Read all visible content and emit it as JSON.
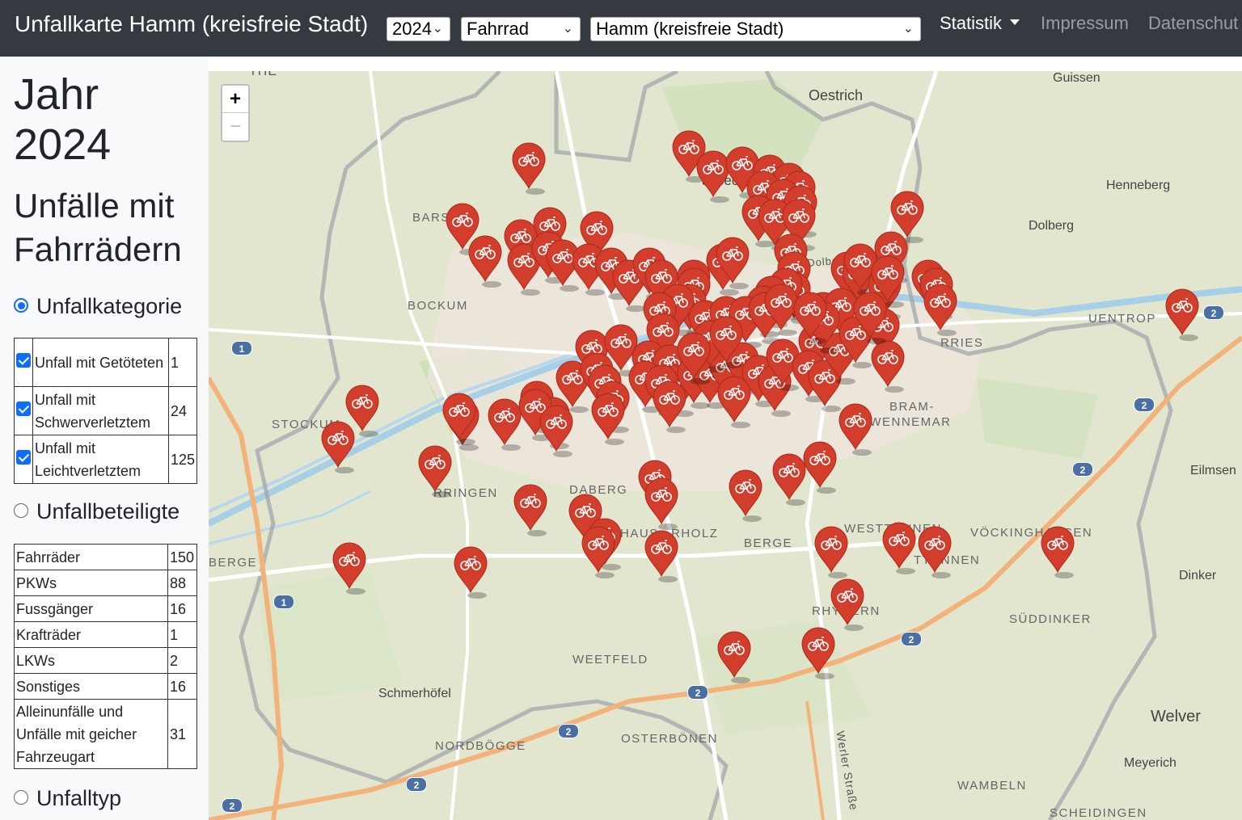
{
  "navbar": {
    "brand": "Unfallkarte Hamm (kreisfreie Stadt)",
    "year_select": "2024",
    "vehicle_select": "Fahrrad",
    "region_select": "Hamm (kreisfreie Stadt)",
    "links": [
      "Statistik",
      "Impressum",
      "Datenschut"
    ]
  },
  "sidebar": {
    "year_title": "Jahr 2024",
    "subtitle": "Unfälle mit Fahrrädern",
    "section_category": "Unfallkategorie",
    "categories": [
      {
        "label": "Unfall mit Getöteten",
        "count": "1"
      },
      {
        "label": "Unfall mit Schwerverletztem",
        "count": "24"
      },
      {
        "label": "Unfall mit Leichtverletztem",
        "count": "125"
      }
    ],
    "section_participants": "Unfallbeteiligte",
    "participants": [
      {
        "label": "Fahrräder",
        "count": "150"
      },
      {
        "label": "PKWs",
        "count": "88"
      },
      {
        "label": "Fussgänger",
        "count": "16"
      },
      {
        "label": "Krafträder",
        "count": "1"
      },
      {
        "label": "LKWs",
        "count": "2"
      },
      {
        "label": "Sonstiges",
        "count": "16"
      },
      {
        "label": "Alleinunfälle und Unfälle mit geicher Fahrzeugart",
        "count": "31"
      }
    ],
    "section_type": "Unfalltyp"
  },
  "map": {
    "zoom_in": "+",
    "zoom_out": "−",
    "marker_color": "#d33d2b",
    "marker_icon": "bicycle-icon",
    "places": [
      "Oestrich",
      "Guissen",
      "Henneberg",
      "Dolberg",
      "BARSEN",
      "BOCKUM",
      "UENTROP",
      "RRIES",
      "STOCKUM",
      "DABERG",
      "RRINGEN",
      "LOHAUS",
      "RHOLZ",
      "BERGE",
      "WESTTÜNNEN",
      "VÖCKINGHAUSEN",
      "Eilmsen",
      "Dinker",
      "SÜDDINKER",
      "WEETFELD",
      "Schmerhöfel",
      "NORDBÖGGE",
      "OSTERBÖNEN",
      "WAMBELN",
      "SCHEIDINGEN",
      "Welver",
      "Meyerich",
      "Werler Straße",
      "Dolberger Straße",
      "asbeck",
      "BRAM-",
      "OSTWENNEMAR",
      "TTÜNNEN",
      "RHYNERN",
      "BERGE",
      "THE"
    ]
  }
}
